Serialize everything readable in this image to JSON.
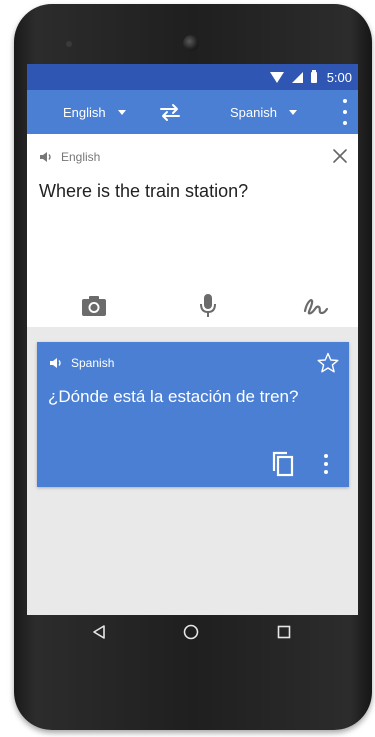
{
  "status_bar": {
    "time": "5:00",
    "wifi_icon": "wifi-icon",
    "signal_icon": "signal-icon",
    "battery_icon": "battery-icon"
  },
  "toolbar": {
    "source_language": "English",
    "target_language": "Spanish",
    "swap_icon": "swap-arrows-icon",
    "menu_icon": "more-vert-icon"
  },
  "input": {
    "language_label": "English",
    "text": "Where is the train station?",
    "speaker_icon": "speaker-icon",
    "close_icon": "close-icon",
    "tools": [
      {
        "name": "camera-icon"
      },
      {
        "name": "microphone-icon"
      },
      {
        "name": "handwriting-icon"
      }
    ]
  },
  "result": {
    "language_label": "Spanish",
    "text": "¿Dónde está la estación de tren?",
    "star_icon": "star-icon",
    "copy_icon": "copy-icon",
    "menu_icon": "more-vert-icon"
  },
  "nav_bar": {
    "back_icon": "back-triangle-icon",
    "home_icon": "home-circle-icon",
    "recents_icon": "recents-square-icon"
  },
  "colors": {
    "status_bar": "#2f56b3",
    "toolbar": "#4a7fd4",
    "result_card": "#4a7fd4",
    "screen_background": "#e9e9e9",
    "phone_body": "#1f1f1f"
  }
}
